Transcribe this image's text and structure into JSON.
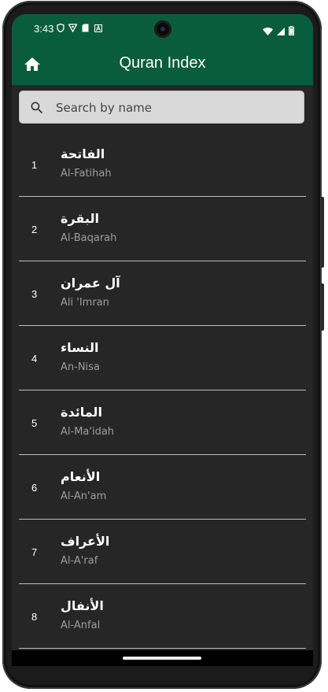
{
  "status_bar": {
    "time": "3:43",
    "left_icons": [
      "shield-icon",
      "vpn-icon",
      "sd-card-icon",
      "accessibility-icon"
    ],
    "right_icons": [
      "wifi-icon",
      "signal-icon",
      "battery-icon"
    ]
  },
  "app_bar": {
    "title": "Quran Index",
    "home_icon": "home-icon",
    "color": "#0a5c3f"
  },
  "search": {
    "placeholder": "Search by name",
    "value": ""
  },
  "surahs": [
    {
      "number": "1",
      "arabic": "الفاتحة",
      "latin": "Al-Fatihah"
    },
    {
      "number": "2",
      "arabic": "البقرة",
      "latin": "Al-Baqarah"
    },
    {
      "number": "3",
      "arabic": "آل عمران",
      "latin": "Ali 'Imran"
    },
    {
      "number": "4",
      "arabic": "النساء",
      "latin": "An-Nisa"
    },
    {
      "number": "5",
      "arabic": "المائدة",
      "latin": "Al-Ma'idah"
    },
    {
      "number": "6",
      "arabic": "الأنعام",
      "latin": "Al-An'am"
    },
    {
      "number": "7",
      "arabic": "الأعراف",
      "latin": "Al-A'raf"
    },
    {
      "number": "8",
      "arabic": "الأنفال",
      "latin": "Al-Anfal"
    }
  ],
  "colors": {
    "background": "#262626",
    "divider": "#bdbdbd",
    "subtitle": "#9e9e9e"
  }
}
